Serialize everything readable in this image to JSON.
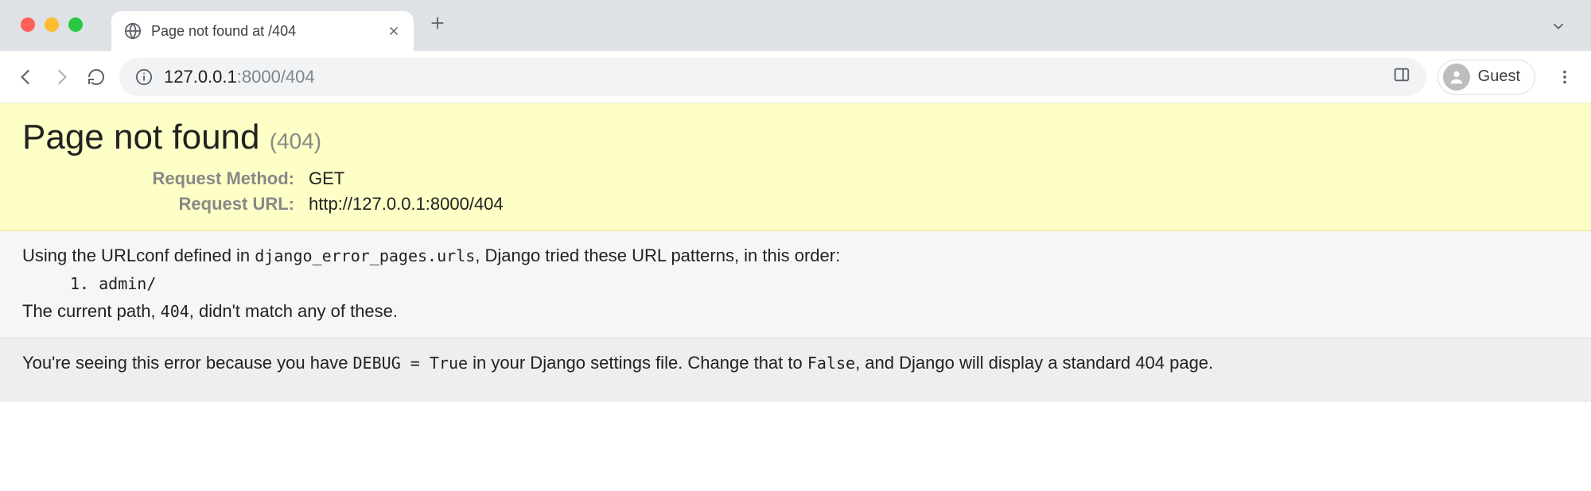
{
  "tab": {
    "title": "Page not found at /404"
  },
  "url": {
    "host": "127.0.0.1",
    "rest": ":8000/404"
  },
  "guest_label": "Guest",
  "django": {
    "heading": "Page not found",
    "status": "(404)",
    "request_method_label": "Request Method:",
    "request_method_value": "GET",
    "request_url_label": "Request URL:",
    "request_url_value": "http://127.0.0.1:8000/404",
    "body_pre": "Using the URLconf defined in ",
    "urlconf": "django_error_pages.urls",
    "body_post": ", Django tried these URL patterns, in this order:",
    "pattern_1": "1. admin/",
    "nomatch_pre": "The current path, ",
    "nomatch_path": "404",
    "nomatch_post": ", didn't match any of these.",
    "footer_pre": "You're seeing this error because you have ",
    "footer_debug": "DEBUG = True",
    "footer_mid": " in your Django settings file. Change that to ",
    "footer_false": "False",
    "footer_post": ", and Django will display a standard 404 page."
  }
}
